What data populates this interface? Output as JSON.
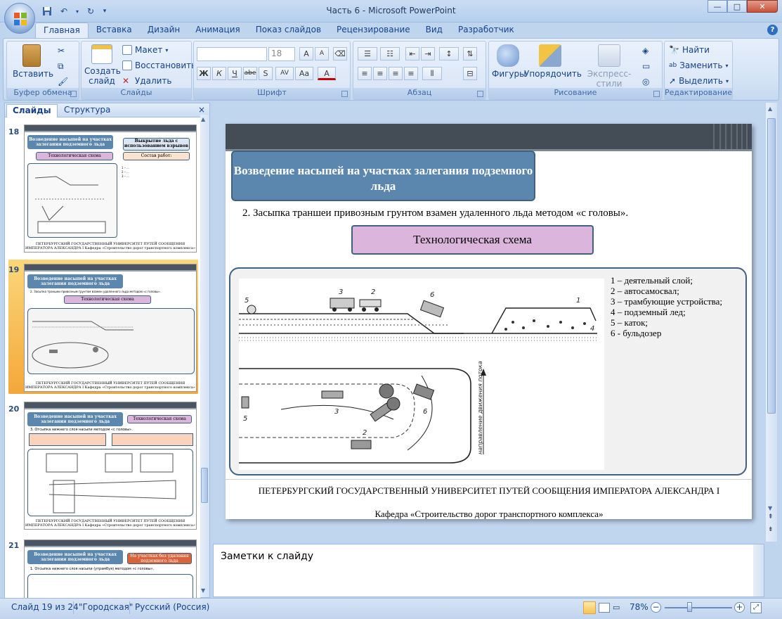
{
  "window": {
    "title": "Часть 6 - Microsoft PowerPoint",
    "controls": {
      "minimize": "—",
      "maximize": "□",
      "close": "✕"
    }
  },
  "qat": {
    "save": "save-icon",
    "undo": "undo-icon",
    "redo": "redo-icon"
  },
  "ribbon_tabs": [
    "Главная",
    "Вставка",
    "Дизайн",
    "Анимация",
    "Показ слайдов",
    "Рецензирование",
    "Вид",
    "Разработчик"
  ],
  "ribbon": {
    "clipboard": {
      "paste": "Вставить",
      "label": "Буфер обмена"
    },
    "slides": {
      "create": "Создать",
      "create2": "слайд",
      "layout": "Макет",
      "restore": "Восстановить",
      "delete": "Удалить",
      "label": "Слайды"
    },
    "font": {
      "size": "18",
      "bold": "Ж",
      "italic": "К",
      "underline": "Ч",
      "strike": "abe",
      "shadow": "S",
      "spacing": "AV",
      "case": "Aa",
      "color": "A",
      "grow": "A",
      "shrink": "A",
      "label": "Шрифт"
    },
    "paragraph": {
      "label": "Абзац"
    },
    "drawing": {
      "shapes": "Фигуры",
      "arrange": "Упорядочить",
      "styles": "Экспресс-стили",
      "label": "Рисование"
    },
    "editing": {
      "find": "Найти",
      "replace": "Заменить",
      "select": "Выделить",
      "label": "Редактирование"
    }
  },
  "pane": {
    "tab_slides": "Слайды",
    "tab_outline": "Структура",
    "close": "×",
    "thumbnails": [
      {
        "num": "18",
        "title": "Возведение насыпей на участках залегания подземного льда",
        "box2": "Выкрытие льда с использованием взрывов",
        "box3": "Технологическая схема",
        "box4": "Состав работ:",
        "foot": "ПЕТЕРБУРГСКИЙ ГОСУДАРСТВЕННЫЙ УНИВЕРСИТЕТ ПУТЕЙ СООБЩЕНИЯ ИМПЕРАТОРА АЛЕКСАНДРА I Кафедра «Строительство дорог транспортного комплекса»"
      },
      {
        "num": "19",
        "title": "Возведение насыпей на участках залегания подземного льда",
        "box3": "Технологическая схема",
        "foot": "ПЕТЕРБУРГСКИЙ ГОСУДАРСТВЕННЫЙ УНИВЕРСИТЕТ ПУТЕЙ СООБЩЕНИЯ ИМПЕРАТОРА АЛЕКСАНДРА I Кафедра «Строительство дорог транспортного комплекса»"
      },
      {
        "num": "20",
        "title": "Возведение насыпей на участках залегания подземного льда",
        "box2": "Технологическая схема",
        "sub": "3. Отсыпка нижнего слоя насыпи методом «с головы».",
        "foot": "ПЕТЕРБУРГСКИЙ ГОСУДАРСТВЕННЫЙ УНИВЕРСИТЕТ ПУТЕЙ СООБЩЕНИЯ ИМПЕРАТОРА АЛЕКСАНДРА I Кафедра «Строительство дорог транспортного комплекса»"
      },
      {
        "num": "21",
        "title": "Возведение насыпей на участках залегания подземного льда",
        "box2": "На участках без удаления подземного льда",
        "sub": "1. Отсыпка нижнего слоя насыпи (утрамбуя) методом «с головы»."
      }
    ]
  },
  "slide": {
    "title": "Возведение насыпей на участках залегания подземного льда",
    "subtitle": "2. Засыпка траншеи привозным грунтом взамен удаленного льда методом «с головы».",
    "scheme_label": "Технологическая схема",
    "legend": [
      "1 – деятельный слой;",
      "2 – автосамосвал;",
      "3 – трамбующие устройства;",
      "4 – подземный лед;",
      "5 – каток;",
      "6 - бульдозер"
    ],
    "footer1": "ПЕТЕРБУРГСКИЙ ГОСУДАРСТВЕННЫЙ УНИВЕРСИТЕТ ПУТЕЙ СООБЩЕНИЯ ИМПЕРАТОРА АЛЕКСАНДРА I",
    "footer2": "Кафедра «Строительство дорог транспортного комплекса»",
    "drawing_text": {
      "l1": "1",
      "l2": "2",
      "l3": "3",
      "l4": "4",
      "l5": "5",
      "l6": "6",
      "direction": "направление движения потока"
    }
  },
  "notes": {
    "placeholder": "Заметки к слайду"
  },
  "status": {
    "slide": "Слайд 19 из 24",
    "theme": "\"Городская\"",
    "lang": "Русский (Россия)",
    "zoom": "78%"
  }
}
